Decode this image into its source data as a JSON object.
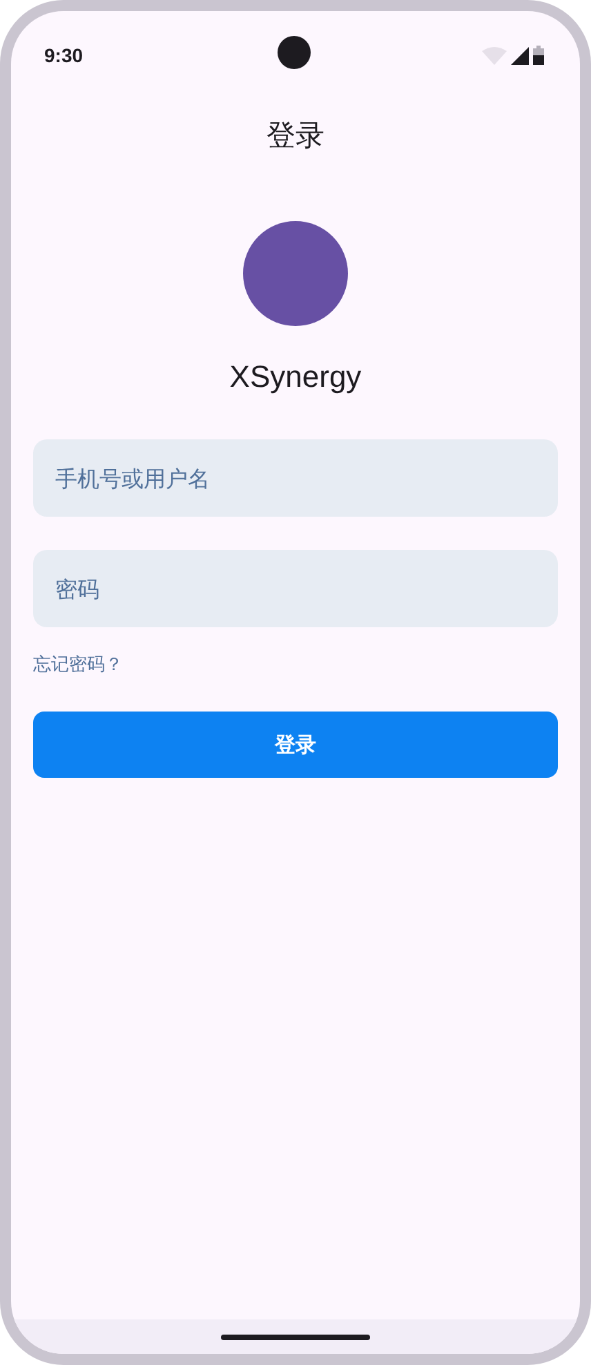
{
  "status_bar": {
    "time": "9:30"
  },
  "title": "登录",
  "app_name": "XSynergy",
  "fields": [
    {
      "placeholder": "手机号或用户名"
    },
    {
      "placeholder": "密码"
    }
  ],
  "forgot_link": "忘记密码？",
  "login_button": "登录"
}
